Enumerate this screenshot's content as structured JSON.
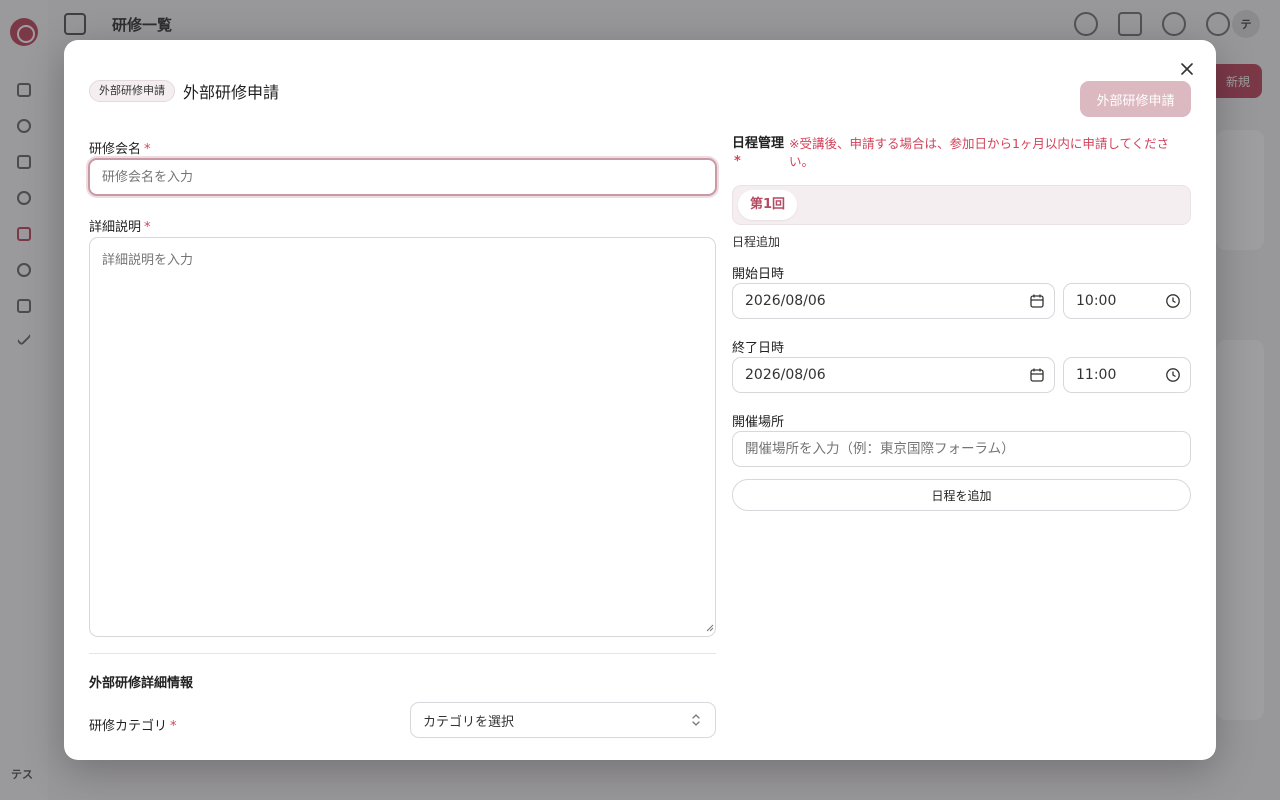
{
  "background": {
    "header_title": "研修一覧",
    "user_initials": "テス",
    "avatar_initial": "テ",
    "primary_button_label": "新規"
  },
  "modal": {
    "badge": "外部研修申請",
    "title": "外部研修申請",
    "submit_label": "外部研修申請",
    "left": {
      "name_label": "研修会名",
      "name_placeholder": "研修会名を入力",
      "desc_label": "詳細説明",
      "desc_placeholder": "詳細説明を入力",
      "section_title": "外部研修詳細情報",
      "category_label": "研修カテゴリ",
      "category_placeholder": "カテゴリを選択",
      "required_mark": "*"
    },
    "right": {
      "schedule_label": "日程管理",
      "schedule_note": "※受講後、申請する場合は、参加日から1ヶ月以内に申請してください。",
      "tab_label": "第1回",
      "add_schedule_link": "日程追加",
      "start_label": "開始日時",
      "start_date": "2026/08/06",
      "start_time": "10:00",
      "end_label": "終了日時",
      "end_date": "2026/08/06",
      "end_time": "11:00",
      "venue_label": "開催場所",
      "venue_placeholder": "開催場所を入力（例：東京国際フォーラム）",
      "add_schedule_button": "日程を追加"
    }
  },
  "colors": {
    "accent": "#c0485f",
    "required": "#d3435b",
    "submit_disabled": "#dcb8c0",
    "tab_text": "#b54b62"
  }
}
